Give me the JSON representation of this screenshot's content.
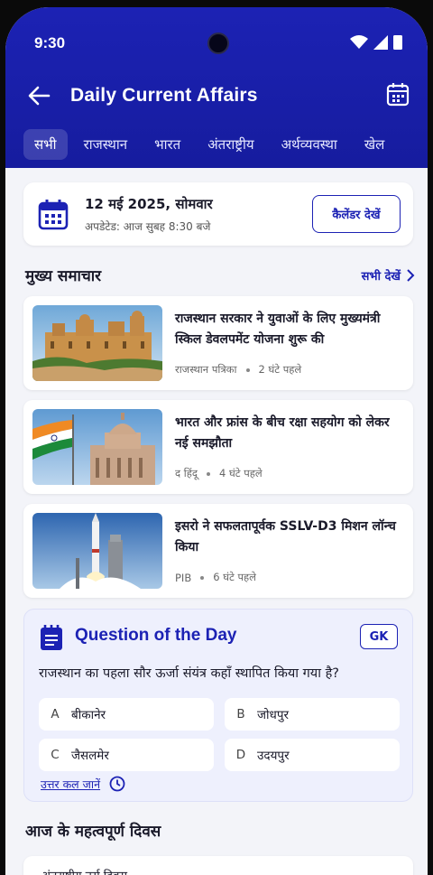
{
  "status_bar": {
    "time": "9:30"
  },
  "header": {
    "title": "Daily Current Affairs",
    "back_icon": "back-arrow-icon",
    "calendar_icon": "calendar-icon"
  },
  "tabs": [
    {
      "label": "सभी",
      "active": true
    },
    {
      "label": "राजस्थान",
      "active": false
    },
    {
      "label": "भारत",
      "active": false
    },
    {
      "label": "अंतराष्ट्रीय",
      "active": false
    },
    {
      "label": "अर्थव्यवस्था",
      "active": false
    },
    {
      "label": "खेल",
      "active": false
    }
  ],
  "date_card": {
    "date": "12 मई 2025, सोमवार",
    "updated": "अपडेटेड: आज सुबह 8:30 बजे",
    "button_label": "कैलेंडर देखें"
  },
  "top_news": {
    "title": "मुख्य समाचार",
    "see_all": "सभी देखें",
    "items": [
      {
        "headline": "राजस्थान सरकार ने युवाओं के लिए मुख्यमंत्री स्किल डेवलपमेंट योजना शुरू की",
        "source": "राजस्थान पत्रिका",
        "time": "2 घंटे पहले"
      },
      {
        "headline": "भारत और फ्रांस के बीच रक्षा सहयोग को लेकर नई समझौता",
        "source": "द हिंदू",
        "time": "4 घंटे पहले"
      },
      {
        "headline": "इसरो ने सफलतापूर्वक SSLV-D3 मिशन लॉन्च किया",
        "source": "PIB",
        "time": "6 घंटे पहले"
      }
    ]
  },
  "question_of_day": {
    "title": "Question of the Day",
    "badge": "GK",
    "question": "राजस्थान का पहला सौर ऊर्जा संयंत्र कहाँ स्थापित किया गया है?",
    "options": [
      {
        "key": "A",
        "text": "बीकानेर"
      },
      {
        "key": "B",
        "text": "जोधपुर"
      },
      {
        "key": "C",
        "text": "जैसलमेर"
      },
      {
        "key": "D",
        "text": "उदयपुर"
      }
    ],
    "answer_link": "उत्तर कल जानें"
  },
  "important_days": {
    "title": "आज के महत्वपूर्ण दिवस",
    "first_item": "अंतराष्ट्रीय नर्स दिवस"
  },
  "colors": {
    "primary": "#1c22b4",
    "background": "#f3f4f9"
  }
}
